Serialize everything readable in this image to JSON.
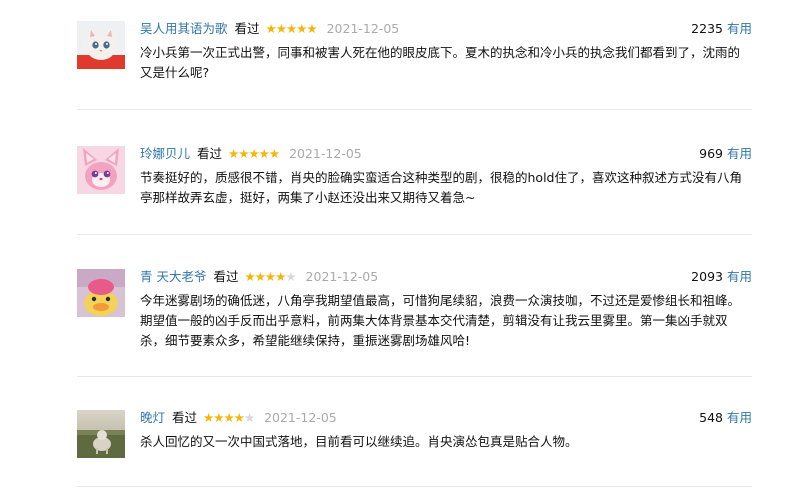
{
  "comments": [
    {
      "user": "吴人用其语为歌",
      "status": "看过",
      "rating": 5,
      "time": "2021-12-05",
      "votes": "2235",
      "useful_label": "有用",
      "text": "冷小兵第一次正式出警，同事和被害人死在他的眼皮底下。夏木的执念和冷小兵的执念我们都看到了，沈雨的又是什么呢?"
    },
    {
      "user": "玲娜贝儿",
      "status": "看过",
      "rating": 5,
      "time": "2021-12-05",
      "votes": "969",
      "useful_label": "有用",
      "text": "节奏挺好的，质感很不错，肖央的脸确实蛮适合这种类型的剧，很稳的hold住了，喜欢这种叙述方式没有八角亭那样故弄玄虚，挺好，两集了小赵还没出来又期待又着急~"
    },
    {
      "user": "青 天大老爷",
      "status": "看过",
      "rating": 4,
      "time": "2021-12-05",
      "votes": "2093",
      "useful_label": "有用",
      "text": "今年迷雾剧场的确低迷，八角亭我期望值最高，可惜狗尾续貂，浪费一众演技咖，不过还是爱惨组长和祖峰。期望值一般的凶手反而出乎意料，前两集大体背景基本交代清楚，剪辑没有让我云里雾里。第一集凶手就双杀，细节要素众多，希望能继续保持，重振迷雾剧场雄风哈!"
    },
    {
      "user": "晚灯",
      "status": "看过",
      "rating": 4,
      "time": "2021-12-05",
      "votes": "548",
      "useful_label": "有用",
      "text": "杀人回忆的又一次中国式落地，目前看可以继续追。肖央演怂包真是贴合人物。"
    }
  ],
  "colors": {
    "link": "#3377aa",
    "star": "#f5b50a",
    "star_empty": "#d8d8d8",
    "time": "#aaaaaa",
    "divider": "#e8e8e8"
  }
}
